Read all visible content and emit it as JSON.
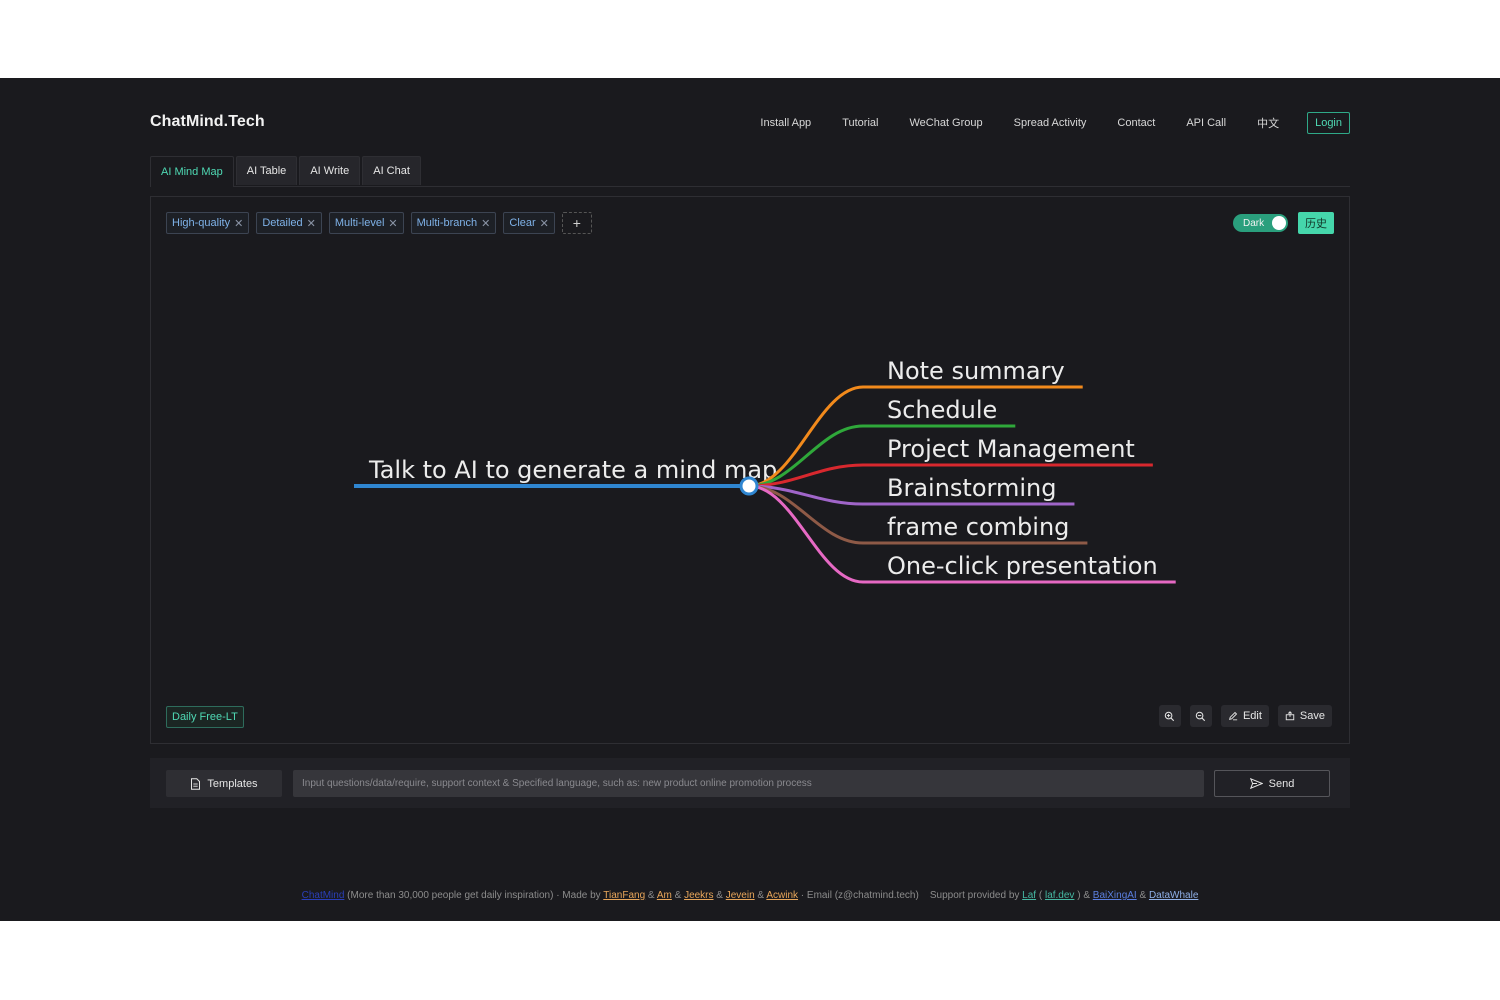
{
  "header": {
    "brand": "ChatMind.Tech",
    "nav": [
      "Install App",
      "Tutorial",
      "WeChat Group",
      "Spread Activity",
      "Contact",
      "API Call",
      "中文"
    ],
    "login_label": "Login"
  },
  "tabs": [
    {
      "label": "AI Mind Map",
      "active": true
    },
    {
      "label": "AI Table",
      "active": false
    },
    {
      "label": "AI Write",
      "active": false
    },
    {
      "label": "AI Chat",
      "active": false
    }
  ],
  "canvas": {
    "tags": [
      "High-quality",
      "Detailed",
      "Multi-level",
      "Multi-branch",
      "Clear"
    ],
    "theme_toggle_label": "Dark",
    "history_label": "历史",
    "quota_label": "Daily Free-LT",
    "edit_label": "Edit",
    "save_label": "Save"
  },
  "mindmap": {
    "root": {
      "label": "Talk to AI to generate a mind map",
      "color": "#2f86d1"
    },
    "branches": [
      {
        "label": "Note summary",
        "color": "#f28a1c"
      },
      {
        "label": "Schedule",
        "color": "#2fa83a"
      },
      {
        "label": "Project Management",
        "color": "#d8282e"
      },
      {
        "label": "Brainstorming",
        "color": "#a065c9"
      },
      {
        "label": "frame combing",
        "color": "#8e5a47"
      },
      {
        "label": "One-click presentation",
        "color": "#e669c4"
      }
    ]
  },
  "input_bar": {
    "templates_label": "Templates",
    "placeholder": "Input questions/data/require, support context & Specified language, such as: new product online promotion process",
    "send_label": "Send"
  },
  "footer": {
    "brand_link": "ChatMind",
    "inspiration": " (More than 30,000 people get daily inspiration) · Made by ",
    "authors": [
      "TianFang",
      "Am",
      "Jeekrs",
      "Jevein",
      "Acwink"
    ],
    "amp": " & ",
    "email": " · Email (z@chatmind.tech)    Support provided by ",
    "laf": "Laf",
    "laf_dev": "laf.dev",
    "paren_open": " ( ",
    "paren_close": " ) & ",
    "baixing": "BaiXingAI",
    "datawhale": "DataWhale"
  },
  "colors": {
    "accent": "#4fd9b4",
    "background": "#1a1a1e"
  }
}
